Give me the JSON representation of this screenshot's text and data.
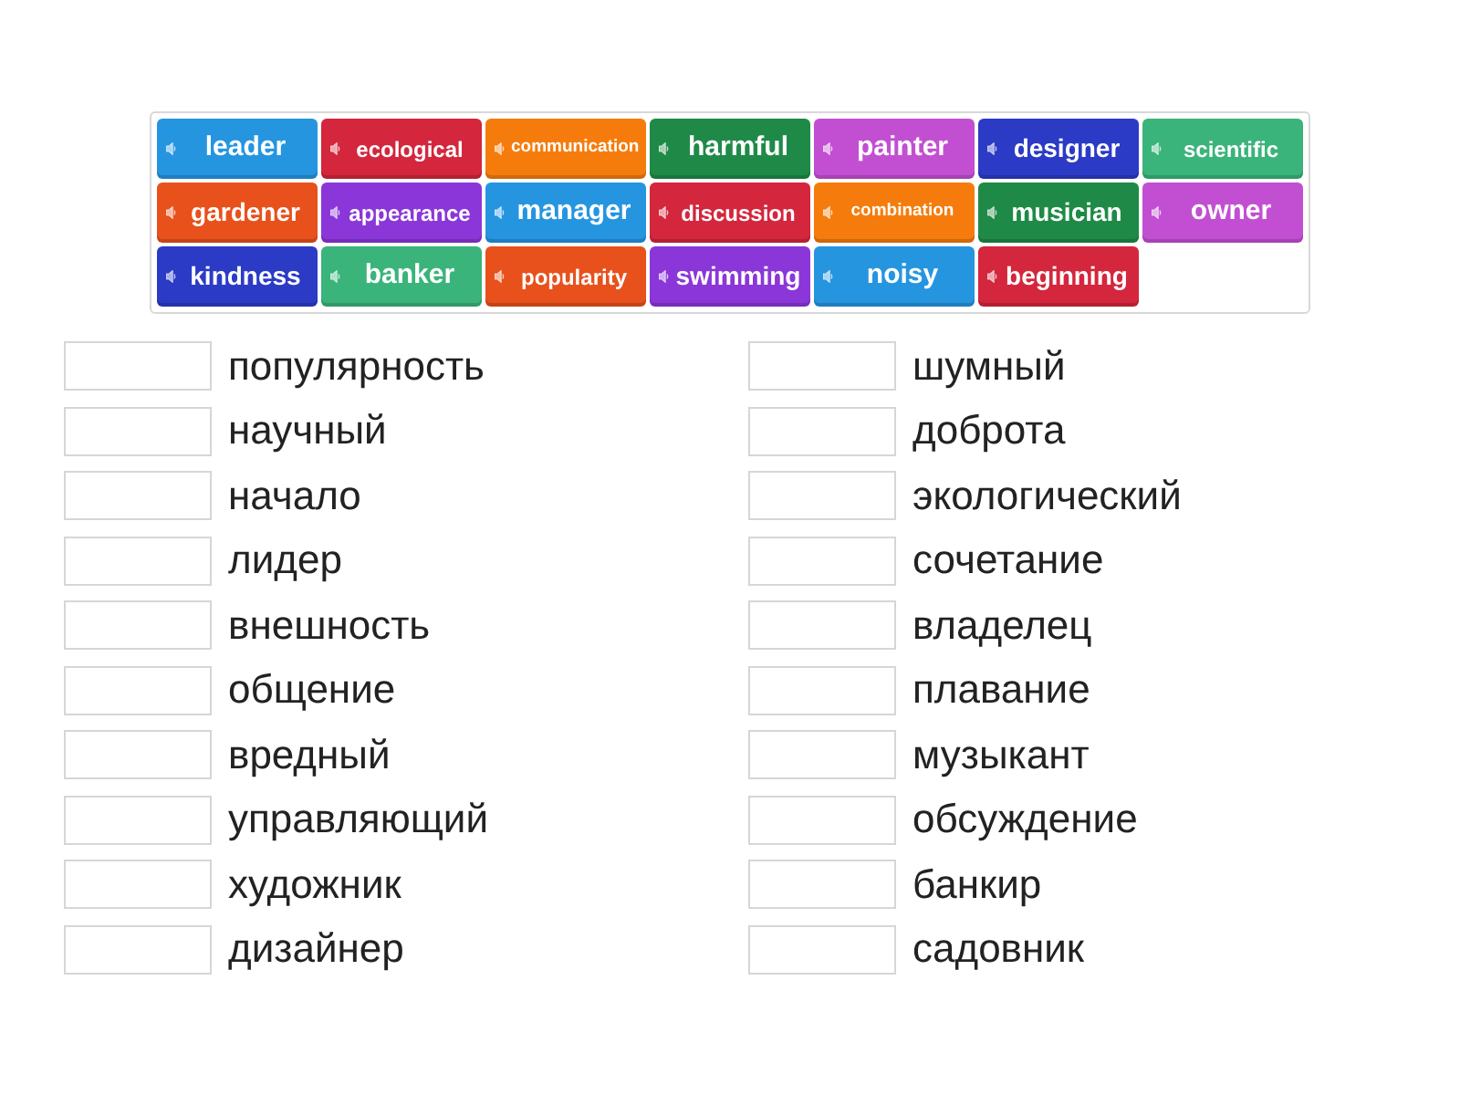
{
  "tiles": [
    {
      "label": "leader",
      "color": "#2595e0"
    },
    {
      "label": "ecological",
      "color": "#d4263c"
    },
    {
      "label": "communication",
      "color": "#f57c0c"
    },
    {
      "label": "harmful",
      "color": "#1f8a47"
    },
    {
      "label": "painter",
      "color": "#c24fd2"
    },
    {
      "label": "designer",
      "color": "#2b3bc6"
    },
    {
      "label": "scientific",
      "color": "#3ab47a"
    },
    {
      "label": "gardener",
      "color": "#e8511c"
    },
    {
      "label": "appearance",
      "color": "#8b36d9"
    },
    {
      "label": "manager",
      "color": "#2595e0"
    },
    {
      "label": "discussion",
      "color": "#d4263c"
    },
    {
      "label": "combination",
      "color": "#f57c0c"
    },
    {
      "label": "musician",
      "color": "#1f8a47"
    },
    {
      "label": "owner",
      "color": "#c24fd2"
    },
    {
      "label": "kindness",
      "color": "#2b3bc6"
    },
    {
      "label": "banker",
      "color": "#3ab47a"
    },
    {
      "label": "popularity",
      "color": "#e8511c"
    },
    {
      "label": "swimming",
      "color": "#8b36d9"
    },
    {
      "label": "noisy",
      "color": "#2595e0"
    },
    {
      "label": "beginning",
      "color": "#d4263c"
    }
  ],
  "left_column": [
    {
      "text": "популярность"
    },
    {
      "text": "научный"
    },
    {
      "text": "начало"
    },
    {
      "text": "лидер"
    },
    {
      "text": "внешность"
    },
    {
      "text": "общение"
    },
    {
      "text": "вредный"
    },
    {
      "text": "управляющий"
    },
    {
      "text": "художник"
    },
    {
      "text": "дизайнер"
    }
  ],
  "right_column": [
    {
      "text": "шумный"
    },
    {
      "text": "доброта"
    },
    {
      "text": "экологический"
    },
    {
      "text": "сочетание"
    },
    {
      "text": "владелец"
    },
    {
      "text": "плавание"
    },
    {
      "text": "музыкант"
    },
    {
      "text": "обсуждение"
    },
    {
      "text": "банкир"
    },
    {
      "text": "садовник"
    }
  ]
}
